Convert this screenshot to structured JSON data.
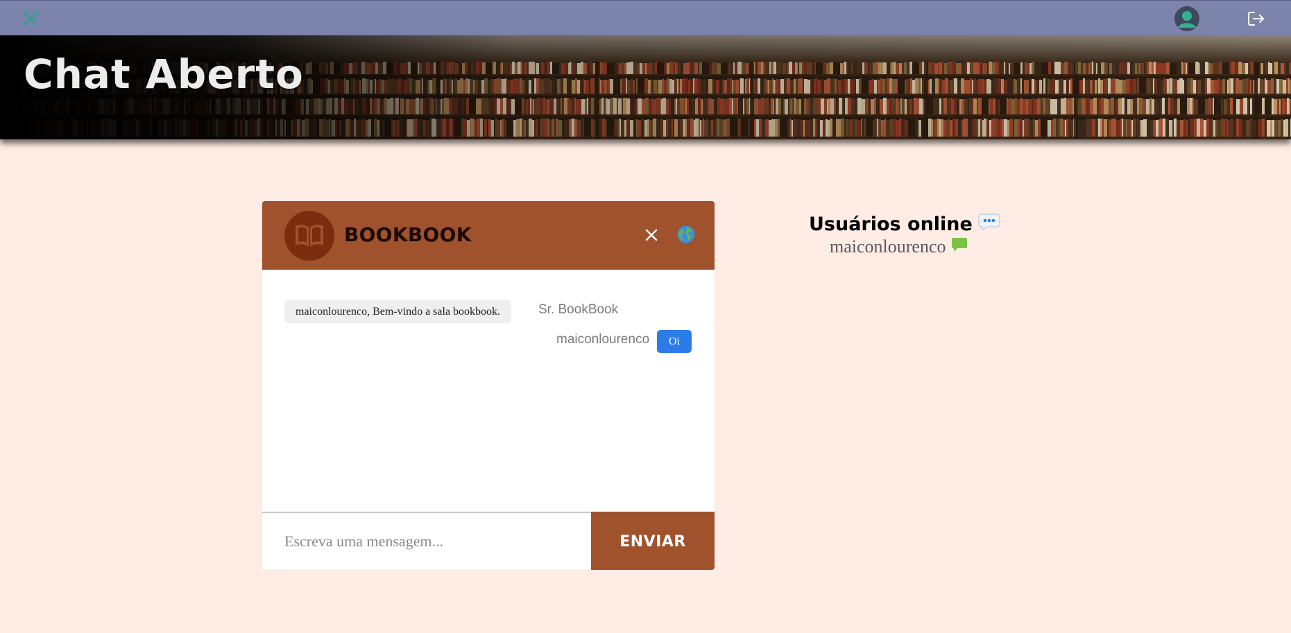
{
  "topbar": {
    "menu_icon": "x-icon",
    "avatar_icon": "user-avatar-icon",
    "logout_icon": "logout-icon",
    "background": "#7d84ab"
  },
  "banner": {
    "title": "Chat Aberto"
  },
  "chat": {
    "room_name": "BOOKBOOK",
    "room_icon": "book-icon",
    "close_icon": "close-icon",
    "globe_icon": "globe-icon",
    "header_color": "#a0522d",
    "messages": [
      {
        "text": "maiconlourenco, Bem-vindo a sala bookbook.",
        "sender": "Sr. BookBook",
        "direction": "incoming"
      },
      {
        "text": "Oi",
        "sender": "maiconlourenco",
        "direction": "outgoing"
      }
    ],
    "input_placeholder": "Escreva uma mensagem...",
    "send_label": "ENVIAR"
  },
  "online": {
    "title": "Usuários online",
    "title_icon": "speech-bubble-icon",
    "users": [
      {
        "name": "maiconlourenco",
        "icon": "chat-bubble-icon"
      }
    ]
  }
}
